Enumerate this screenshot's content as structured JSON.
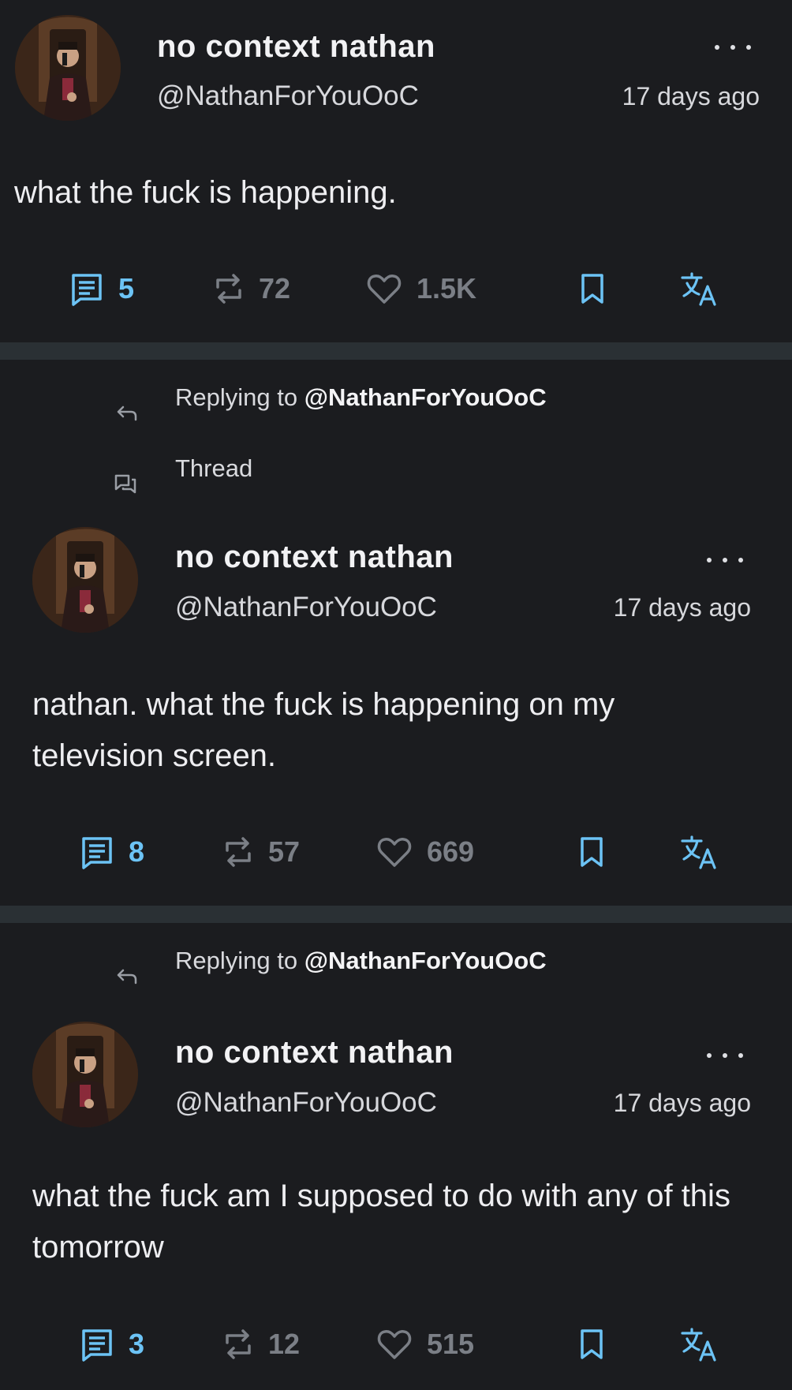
{
  "colors": {
    "background": "#1b1c1f",
    "divider": "#2a3034",
    "accent": "#6cc3f5",
    "muted": "#7b7f86"
  },
  "tweets": [
    {
      "author_name": "no context nathan",
      "handle": "@NathanForYouOoC",
      "time": "17 days ago",
      "text": "what the fuck is happening.",
      "replies": "5",
      "retweets": "72",
      "likes": "1.5K"
    },
    {
      "replying_label": "Replying to",
      "replying_to": "@NathanForYouOoC",
      "thread_label": "Thread",
      "author_name": "no context nathan",
      "handle": "@NathanForYouOoC",
      "time": "17 days ago",
      "text": "nathan. what the fuck is happening on my television screen.",
      "replies": "8",
      "retweets": "57",
      "likes": "669"
    },
    {
      "replying_label": "Replying to",
      "replying_to": "@NathanForYouOoC",
      "author_name": "no context nathan",
      "handle": "@NathanForYouOoC",
      "time": "17 days ago",
      "text": "what the fuck am I supposed to do with any of this tomorrow",
      "replies": "3",
      "retweets": "12",
      "likes": "515"
    }
  ],
  "icons": {
    "reply": "speech-bubble-icon",
    "retweet": "retweet-icon",
    "like": "heart-icon",
    "bookmark": "bookmark-icon",
    "translate": "translate-icon",
    "more": "more-dots-icon",
    "replying": "reply-arrow-icon",
    "thread": "thread-icon"
  }
}
